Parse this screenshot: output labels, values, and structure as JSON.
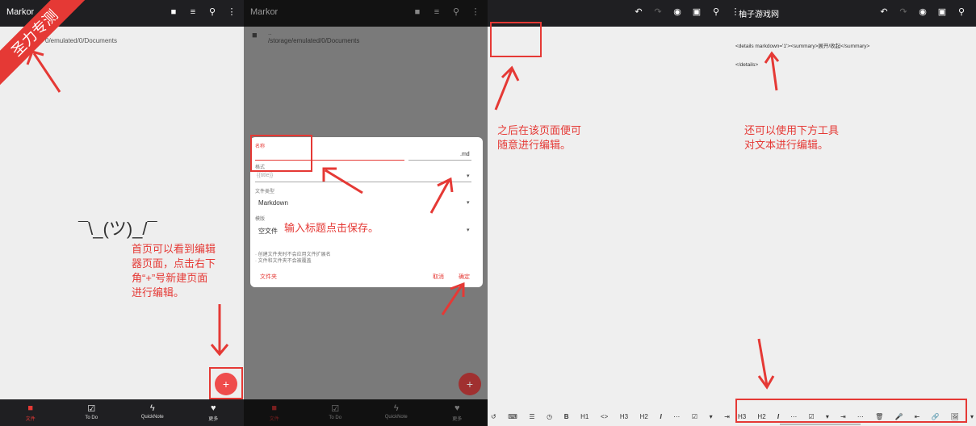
{
  "panel1": {
    "app_title": "Markor",
    "ribbon": "圣力专测",
    "path": "/storage/emulated/0/Documents",
    "path_visible": "0/emulated/0/Documents",
    "shrug": "¯\\_(ツ)_/¯",
    "fab": "+",
    "annotation": [
      "首页可以看到编辑",
      "器页面，点击右下",
      "角“+”号新建页面",
      "进行编辑。"
    ],
    "nav": [
      {
        "label": "文件",
        "icon": "folder-icon",
        "active": true
      },
      {
        "label": "To Do",
        "icon": "todo-icon"
      },
      {
        "label": "QuickNote",
        "icon": "bolt-icon"
      },
      {
        "label": "更多",
        "icon": "heart-icon"
      }
    ]
  },
  "panel2": {
    "app_title": "Markor",
    "up_dir": "..",
    "path": "/storage/emulated/0/Documents",
    "dialog": {
      "name_label": "名称",
      "ext": ".md",
      "format_label": "格式",
      "format_value": "{{title}}",
      "type_label": "文件类型",
      "type_value": "Markdown",
      "template_label": "模版",
      "template_value": "空文件",
      "hint1": "· 创建文件夹时不会应用文件扩展名",
      "hint2": "· 文件和文件夹不会被覆盖",
      "folder_btn": "文件夹",
      "cancel_btn": "取消",
      "ok_btn": "确定"
    },
    "annotation": "输入标题点击保存。",
    "fab": "+",
    "nav": [
      {
        "label": "文件",
        "icon": "folder-icon",
        "active": true
      },
      {
        "label": "To Do",
        "icon": "todo-icon"
      },
      {
        "label": "QuickNote",
        "icon": "bolt-icon"
      },
      {
        "label": "更多",
        "icon": "heart-icon"
      }
    ]
  },
  "panel3": {
    "title": "柚子游戏网",
    "line1": "<details markdown='1'><summary>展开/收起</summary>",
    "line2": "</details>",
    "annotation_left": [
      "之后在该页面便可",
      "随意进行编辑。"
    ],
    "annotation_right": [
      "还可以使用下方工具",
      "对文本进行编辑。"
    ],
    "toolbar_left": [
      "↺",
      "⌨",
      "☰",
      "◷",
      "B",
      "H1",
      "<>",
      "H3",
      "H2",
      "I",
      "⋯",
      "☑",
      "▾",
      "⇥"
    ],
    "toolbar_right": [
      "H3",
      "H2",
      "I",
      "⋯",
      "☑",
      "▾",
      "⇥",
      "⋯",
      "🗑",
      "🎤",
      "⇤",
      "🔗",
      "🖼",
      "▾"
    ]
  }
}
